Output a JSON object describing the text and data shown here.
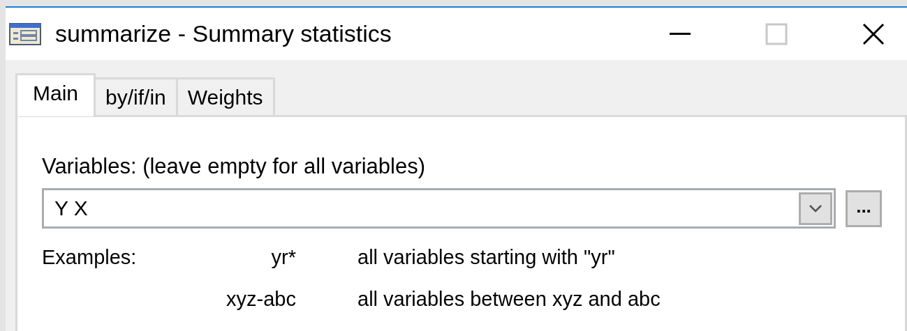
{
  "window": {
    "title": "summarize - Summary statistics"
  },
  "tabs": [
    {
      "label": "Main",
      "selected": true
    },
    {
      "label": "by/if/in",
      "selected": false
    },
    {
      "label": "Weights",
      "selected": false
    }
  ],
  "variables": {
    "label": "Variables: (leave empty for all variables)",
    "value": "Y X",
    "browse_button": "..."
  },
  "examples": {
    "label": "Examples:",
    "rows": [
      {
        "pattern": "yr*",
        "description": "all variables starting with \"yr\""
      },
      {
        "pattern": "xyz-abc",
        "description": "all variables between xyz and abc"
      }
    ]
  }
}
